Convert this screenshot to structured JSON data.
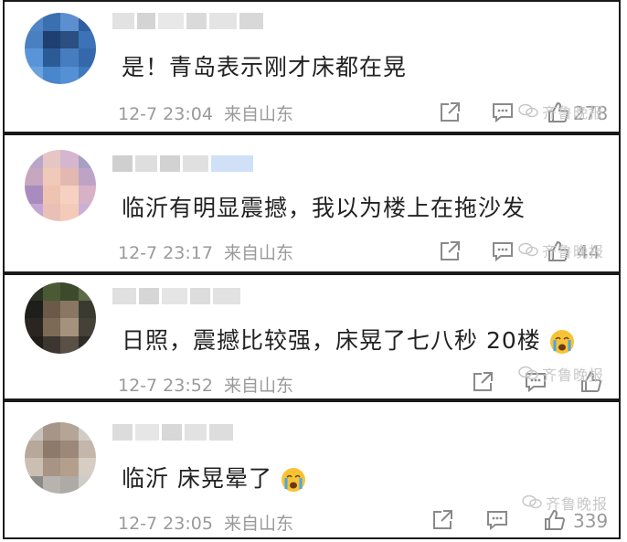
{
  "comments": [
    {
      "text": "是！青岛表示刚才床都在晃",
      "time": "12-7 23:04",
      "source": "来自山东",
      "likes": "278"
    },
    {
      "text": "临沂有明显震撼，我以为楼上在拖沙发",
      "time": "12-7 23:17",
      "source": "来自山东",
      "likes": "44"
    },
    {
      "text": "日照，震撼比较强，床晃了七八秒 20楼",
      "time": "12-7 23:52",
      "source": "来自山东",
      "likes": ""
    },
    {
      "text": "临沂 床晃晕了",
      "time": "12-7 23:05",
      "source": "来自山东",
      "likes": "339"
    }
  ],
  "watermark": "齐鲁晚报",
  "icons": {
    "share": "share-icon",
    "comment": "comment-icon",
    "like": "like-icon",
    "emoji": "crying-face-icon",
    "wechat": "wechat-logo-icon"
  },
  "colors": {
    "border": "#1a1a1a",
    "meta": "#9a9a9a",
    "text": "#222222"
  }
}
